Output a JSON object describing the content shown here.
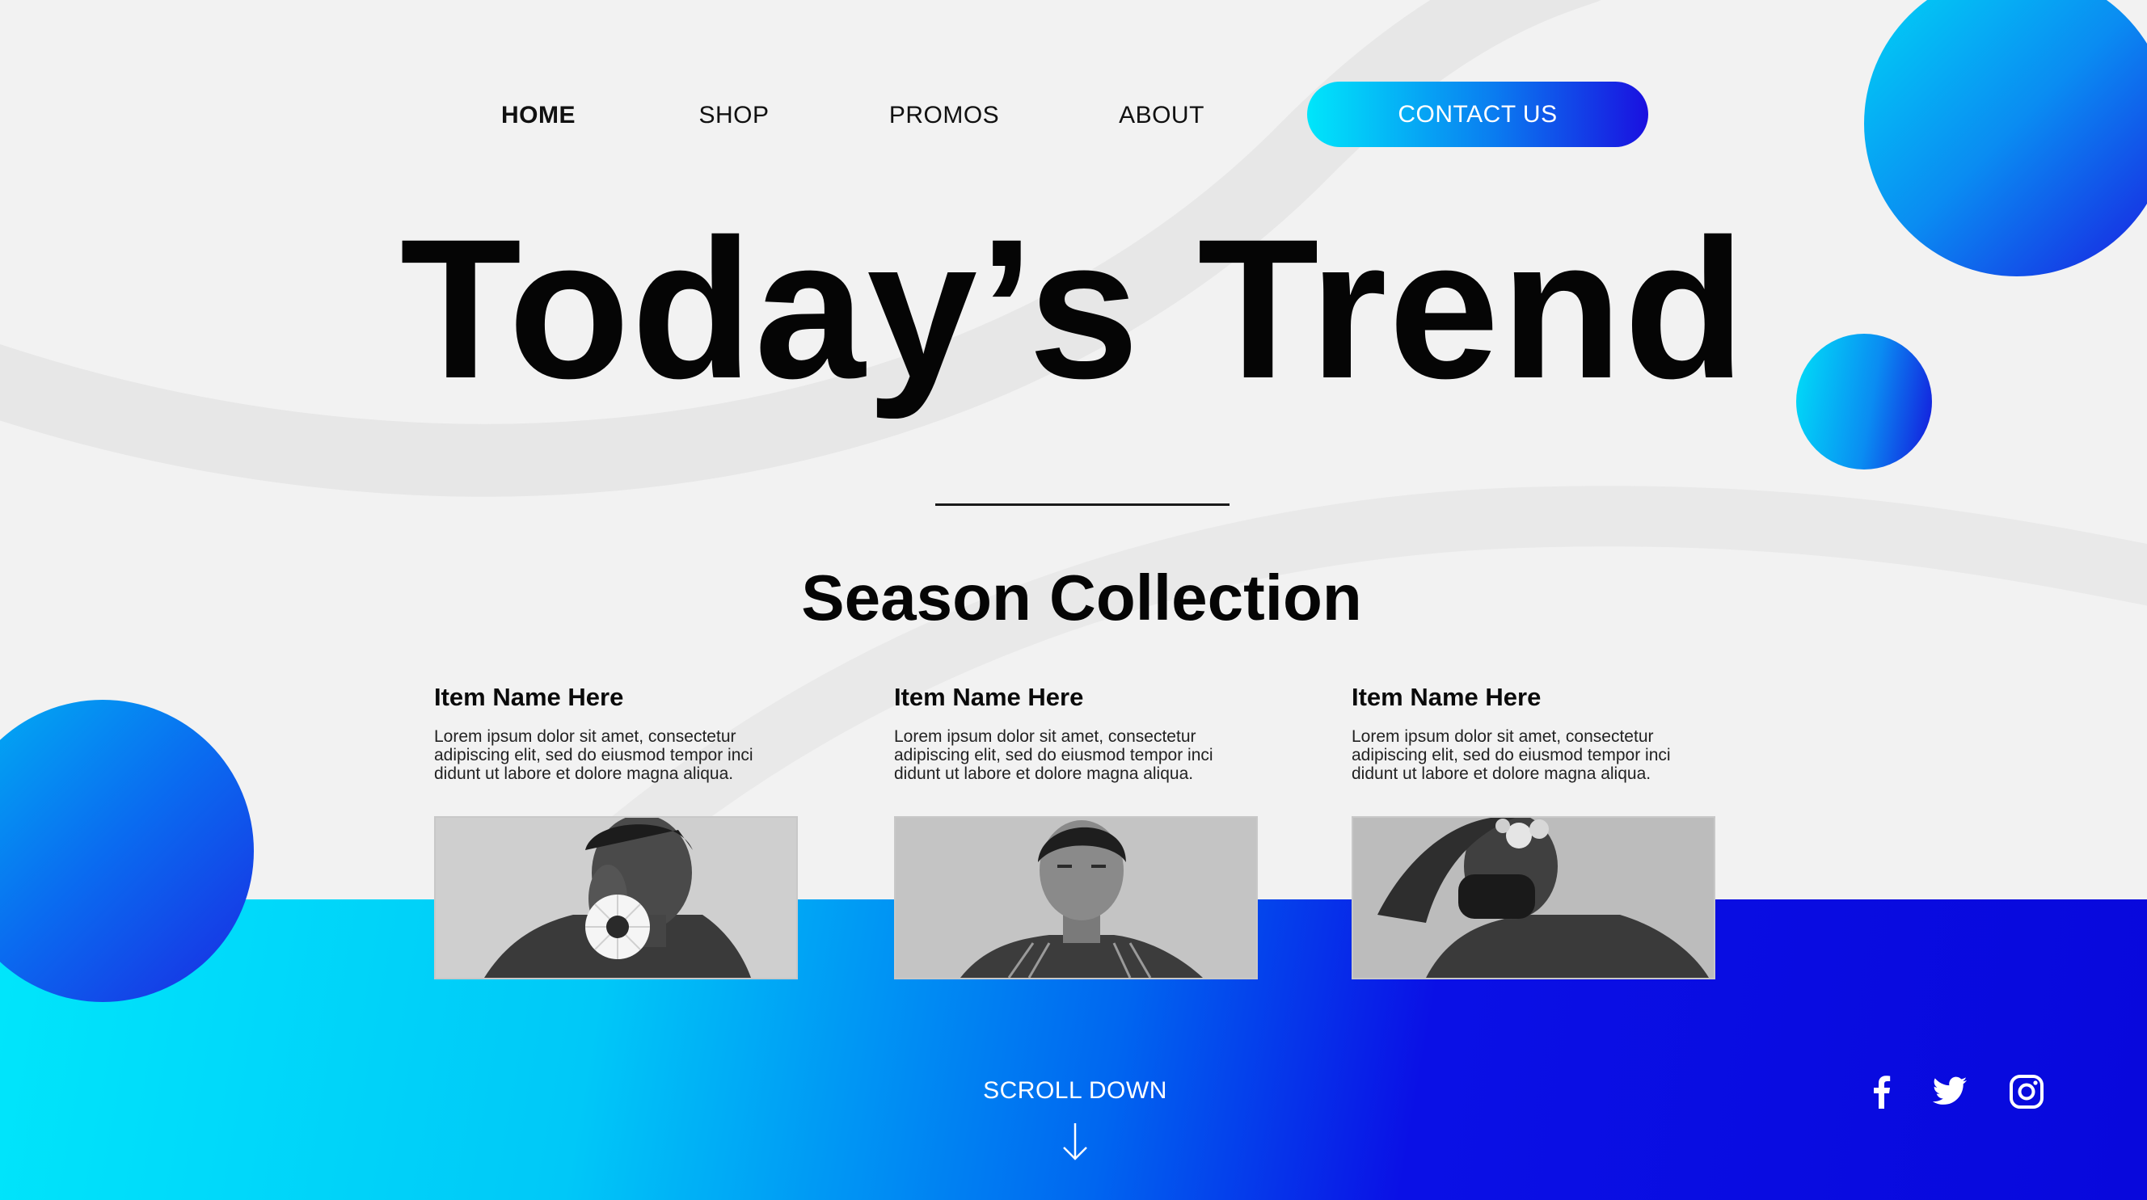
{
  "nav": {
    "items": [
      {
        "label": "HOME",
        "active": true
      },
      {
        "label": "SHOP",
        "active": false
      },
      {
        "label": "PROMOS",
        "active": false
      },
      {
        "label": "ABOUT",
        "active": false
      }
    ],
    "contact_label": "CONTACT US"
  },
  "hero": {
    "title": "Today’s Trend",
    "section_title": "Season Collection"
  },
  "items": [
    {
      "name": "Item Name Here",
      "description": "Lorem ipsum dolor sit amet, consectetur adipiscing elit, sed do eiusmod tempor inci didunt ut labore et dolore magna aliqua.",
      "photo": "man-holding-flower"
    },
    {
      "name": "Item Name Here",
      "description": "Lorem ipsum dolor sit amet, consectetur adipiscing elit, sed do eiusmod tempor inci didunt ut labore et dolore magna aliqua.",
      "photo": "man-portrait"
    },
    {
      "name": "Item Name Here",
      "description": "Lorem ipsum dolor sit amet, consectetur adipiscing elit, sed do eiusmod tempor inci didunt ut labore et dolore magna aliqua.",
      "photo": "man-with-mask"
    }
  ],
  "footer": {
    "scroll_label": "SCROLL DOWN",
    "scroll_icon": "arrow-down-icon",
    "social": [
      "facebook-icon",
      "twitter-icon",
      "instagram-icon"
    ]
  },
  "colors": {
    "accent_cyan": "#00e6fb",
    "accent_blue": "#0808dc",
    "background": "#f2f2f2",
    "text": "#050505"
  }
}
